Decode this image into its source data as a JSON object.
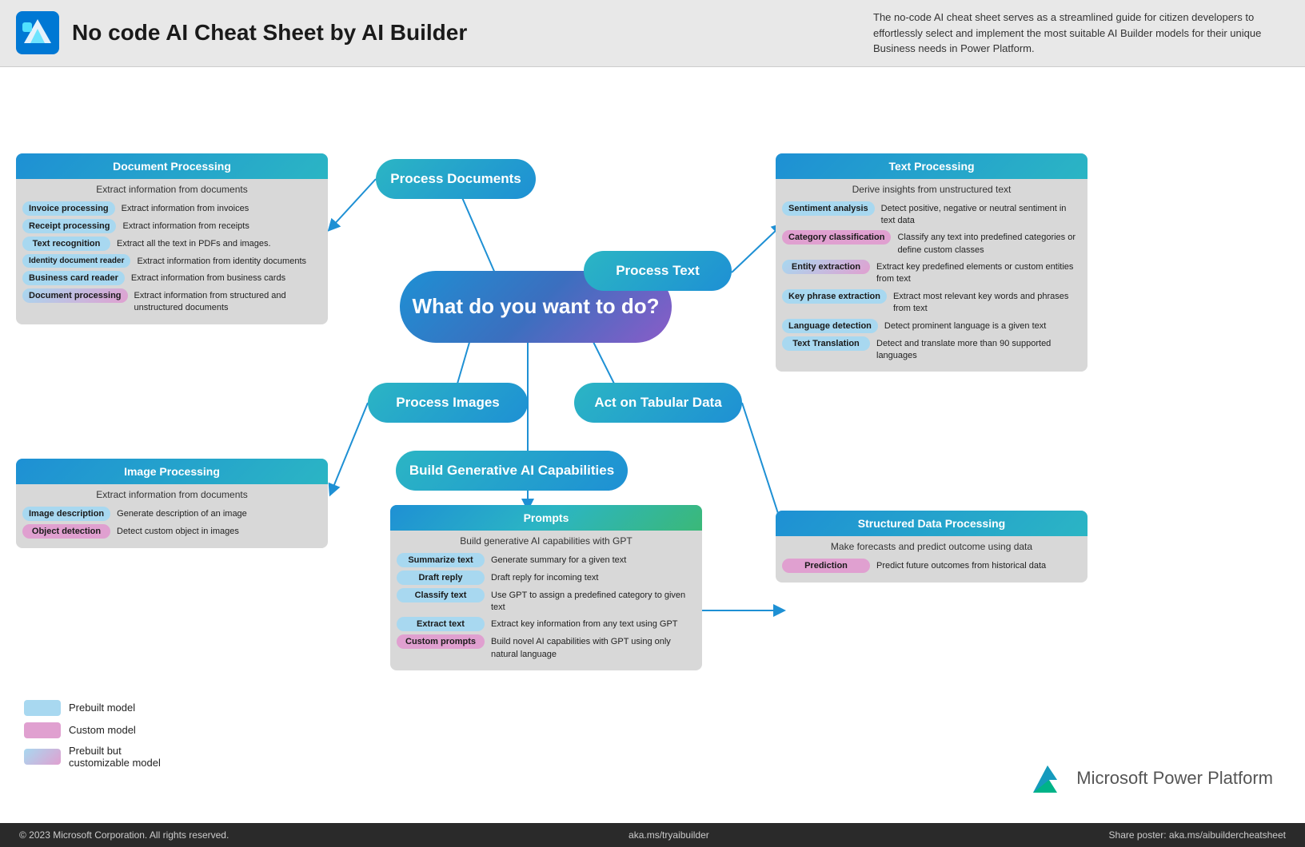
{
  "header": {
    "title": "No code AI Cheat Sheet by AI Builder",
    "description": "The no-code AI cheat sheet serves as a streamlined guide for citizen developers to effortlessly select and implement the most suitable AI Builder models for their unique Business needs in Power Platform."
  },
  "bubbles": {
    "main": "What do you want to do?",
    "process_docs": "Process Documents",
    "process_text": "Process Text",
    "process_images": "Process Images",
    "act_tabular": "Act on Tabular Data",
    "build_generative": "Build Generative AI Capabilities"
  },
  "panels": {
    "document": {
      "title": "Document Processing",
      "subtitle": "Extract information from documents",
      "rows": [
        {
          "tag": "Invoice processing",
          "type": "blue",
          "desc": "Extract information from invoices"
        },
        {
          "tag": "Receipt processing",
          "type": "blue",
          "desc": "Extract information from receipts"
        },
        {
          "tag": "Text  recognition",
          "type": "blue",
          "desc": "Extract all the text in PDFs and images."
        },
        {
          "tag": "Identity document reader",
          "type": "blue",
          "desc": "Extract information from identity documents"
        },
        {
          "tag": "Business card reader",
          "type": "blue",
          "desc": "Extract information from business cards"
        },
        {
          "tag": "Document processing",
          "type": "gradient",
          "desc": "Extract information from structured and unstructured documents"
        }
      ]
    },
    "image": {
      "title": "Image Processing",
      "subtitle": "Extract information from documents",
      "rows": [
        {
          "tag": "Image description",
          "type": "blue",
          "desc": "Generate description of an image"
        },
        {
          "tag": "Object detection",
          "type": "pink",
          "desc": "Detect custom object in images"
        }
      ]
    },
    "text": {
      "title": "Text Processing",
      "subtitle": "Derive insights from unstructured text",
      "rows": [
        {
          "tag": "Sentiment analysis",
          "type": "blue",
          "desc": "Detect positive, negative or neutral sentiment in text data"
        },
        {
          "tag": "Category classification",
          "type": "pink",
          "desc": "Classify any text into predefined categories or define custom classes"
        },
        {
          "tag": "Entity extraction",
          "type": "gradient",
          "desc": "Extract key predefined elements or custom entities from text"
        },
        {
          "tag": "Key phrase extraction",
          "type": "blue",
          "desc": "Extract most relevant key words and phrases from text"
        },
        {
          "tag": "Language detection",
          "type": "blue",
          "desc": "Detect prominent language is a given text"
        },
        {
          "tag": "Text Translation",
          "type": "blue",
          "desc": "Detect and translate more than 90 supported languages"
        }
      ]
    },
    "structured": {
      "title": "Structured Data Processing",
      "subtitle": "Make forecasts and predict outcome using data",
      "rows": [
        {
          "tag": "Prediction",
          "type": "pink",
          "desc": "Predict future outcomes from historical data"
        }
      ]
    },
    "prompts": {
      "title": "Prompts",
      "subtitle": "Build generative AI capabilities with GPT",
      "rows": [
        {
          "tag": "Summarize text",
          "type": "blue",
          "desc": "Generate summary for a given text"
        },
        {
          "tag": "Draft reply",
          "type": "blue",
          "desc": "Draft reply for incoming text"
        },
        {
          "tag": "Classify text",
          "type": "blue",
          "desc": "Use GPT to assign a predefined category to given text"
        },
        {
          "tag": "Extract text",
          "type": "blue",
          "desc": "Extract key information from any text using GPT"
        },
        {
          "tag": "Custom prompts",
          "type": "pink",
          "desc": "Build novel AI capabilities with GPT using only natural language"
        }
      ]
    }
  },
  "legend": {
    "items": [
      {
        "label": "Prebuilt model",
        "type": "blue"
      },
      {
        "label": "Custom model",
        "type": "pink"
      },
      {
        "label": "Prebuilt but customizable model",
        "type": "gradient"
      }
    ]
  },
  "footer": {
    "copyright": "© 2023 Microsoft Corporation. All rights reserved.",
    "link1": "aka.ms/tryaibuilder",
    "link2": "Share poster: aka.ms/aibuildercheatsheet"
  },
  "ms_logo": "Microsoft Power Platform"
}
